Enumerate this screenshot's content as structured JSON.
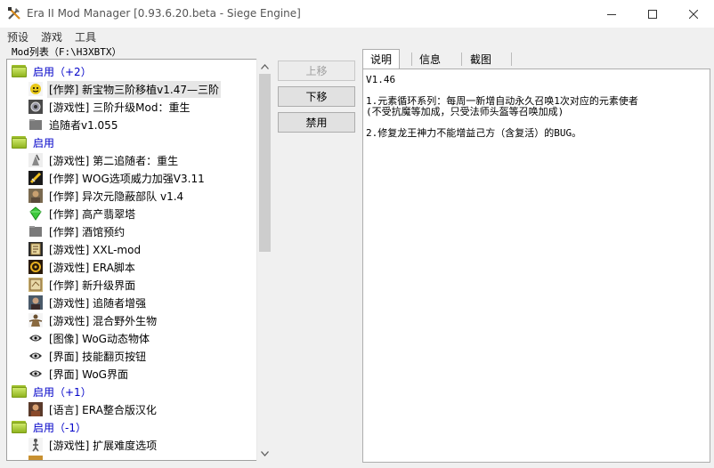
{
  "window": {
    "title": "Era II Mod Manager [0.93.6.20.beta - Siege Engine]"
  },
  "menu": [
    "预设",
    "游戏",
    "工具"
  ],
  "mod_list": {
    "label": "Mod列表（F:\\H3XBTX）",
    "rows": [
      {
        "kind": "group",
        "text": "启用（+2）",
        "icon": "folder-icon"
      },
      {
        "kind": "item",
        "text": "[作弊] 新宝物三阶移植v1.47—三阶",
        "icon": "smiley-icon",
        "selected": true
      },
      {
        "kind": "item",
        "text": "[游戏性] 三阶升级Mod：重生",
        "icon": "gear-icon"
      },
      {
        "kind": "item",
        "text": "追随者v1.055",
        "icon": "grey-folder-icon"
      },
      {
        "kind": "group",
        "text": "启用",
        "icon": "folder-icon"
      },
      {
        "kind": "item",
        "text": "[游戏性] 第二追随者：重生",
        "icon": "knight-icon"
      },
      {
        "kind": "item",
        "text": "[作弊] WOG选项威力加强V3.11",
        "icon": "sword-icon"
      },
      {
        "kind": "item",
        "text": "[作弊] 异次元隐蔽部队 v1.4",
        "icon": "portrait-icon"
      },
      {
        "kind": "item",
        "text": "[作弊] 高产翡翠塔",
        "icon": "emerald-icon"
      },
      {
        "kind": "item",
        "text": "[作弊] 酒馆预约",
        "icon": "grey-folder-icon"
      },
      {
        "kind": "item",
        "text": "[游戏性] XXL-mod",
        "icon": "scroll-icon"
      },
      {
        "kind": "item",
        "text": "[游戏性] ERA脚本",
        "icon": "era-icon"
      },
      {
        "kind": "item",
        "text": "[作弊] 新升级界面",
        "icon": "map-icon"
      },
      {
        "kind": "item",
        "text": "[游戏性] 追随者增强",
        "icon": "portrait-icon"
      },
      {
        "kind": "item",
        "text": "[游戏性] 混合野外生物",
        "icon": "monster-icon"
      },
      {
        "kind": "item",
        "text": "[图像] WoG动态物体",
        "icon": "eye-icon"
      },
      {
        "kind": "item",
        "text": "[界面] 技能翻页按钮",
        "icon": "eye-icon"
      },
      {
        "kind": "item",
        "text": "[界面] WoG界面",
        "icon": "eye-icon"
      },
      {
        "kind": "group",
        "text": "启用（+1）",
        "icon": "folder-icon"
      },
      {
        "kind": "item",
        "text": "[语言] ERA整合版汉化",
        "icon": "portrait-icon"
      },
      {
        "kind": "group",
        "text": "启用（-1）",
        "icon": "folder-icon"
      },
      {
        "kind": "item",
        "text": "[游戏性] 扩展难度选项",
        "icon": "figure-icon"
      }
    ]
  },
  "buttons": {
    "move_up": "上移",
    "move_down": "下移",
    "disable": "禁用"
  },
  "tabs": [
    "说明",
    "信息",
    "截图"
  ],
  "description": {
    "lines": [
      "V1.46",
      "1.元素循环系列：每周一新增自动永久召唤1次对应的元素使者\n(不受抗魔等加成，只受法师头盔等召唤加成)",
      "2.修复龙王神力不能增益己方（含复活）的BUG。"
    ]
  },
  "colors": {
    "group_text": "#0000c8",
    "selected_bg": "#e6e6e6",
    "folder_green": "#9dbe2a"
  }
}
